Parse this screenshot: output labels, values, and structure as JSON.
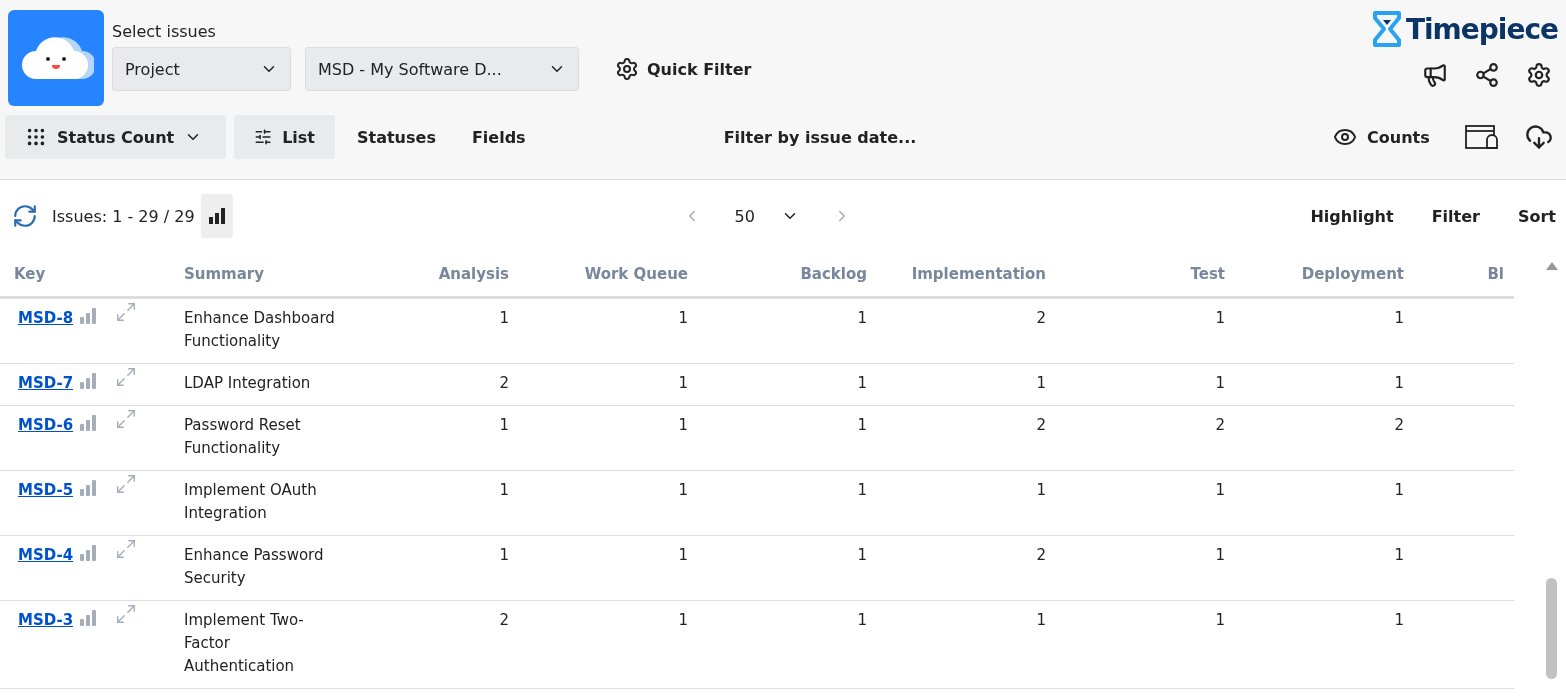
{
  "header": {
    "select_label": "Select issues",
    "dropdowns": [
      {
        "value": "Project"
      },
      {
        "value": "MSD - My Software D..."
      }
    ],
    "quick_filter": "Quick Filter",
    "brand": "Timepiece"
  },
  "toolbar": {
    "view": "Status Count",
    "list": "List",
    "tabs": [
      "Statuses",
      "Fields"
    ],
    "date_filter": "Filter by issue date...",
    "counts": "Counts"
  },
  "results": {
    "issues": "Issues: 1 - 29 / 29",
    "page_size": "50",
    "actions": [
      "Highlight",
      "Filter",
      "Sort"
    ]
  },
  "table": {
    "columns": [
      "Key",
      "Summary",
      "Analysis",
      "Work Queue",
      "Backlog",
      "Implementation",
      "Test",
      "Deployment",
      "Bl"
    ],
    "rows": [
      {
        "key": "MSD-8",
        "summary": "Enhance Dashboard Functionality",
        "values": [
          "1",
          "1",
          "1",
          "2",
          "1",
          "1"
        ]
      },
      {
        "key": "MSD-7",
        "summary": "LDAP Integration",
        "values": [
          "2",
          "1",
          "1",
          "1",
          "1",
          "1"
        ]
      },
      {
        "key": "MSD-6",
        "summary": "Password Reset Functionality",
        "values": [
          "1",
          "1",
          "1",
          "2",
          "2",
          "2"
        ]
      },
      {
        "key": "MSD-5",
        "summary": "Implement OAuth Integration",
        "values": [
          "1",
          "1",
          "1",
          "1",
          "1",
          "1"
        ]
      },
      {
        "key": "MSD-4",
        "summary": "Enhance Password Security",
        "values": [
          "1",
          "1",
          "1",
          "2",
          "1",
          "1"
        ]
      },
      {
        "key": "MSD-3",
        "summary": "Implement Two-Factor Authentication",
        "values": [
          "2",
          "1",
          "1",
          "1",
          "1",
          "1"
        ]
      }
    ]
  }
}
